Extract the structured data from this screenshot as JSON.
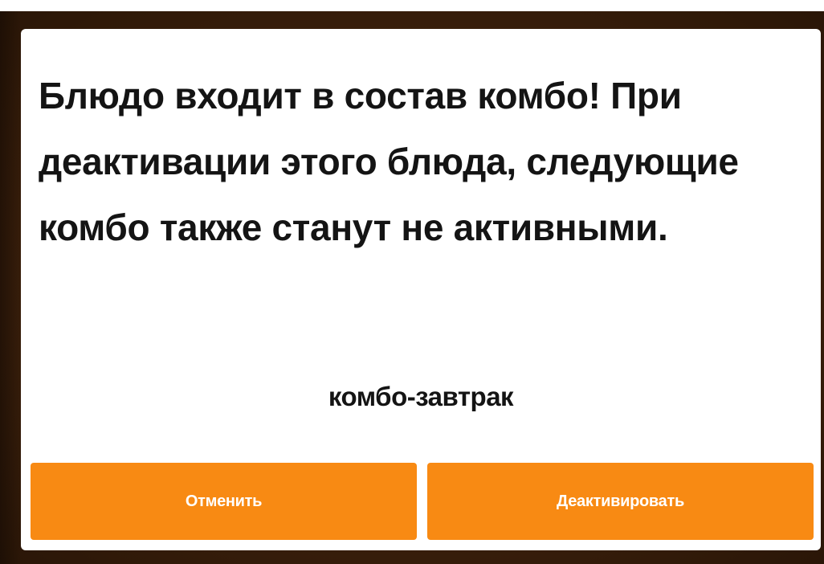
{
  "dialog": {
    "message": "Блюдо входит в состав комбо! При деактивации этого блюда, следующие комбо также станут не активными.",
    "combo_name": "комбо-завтрак",
    "cancel_label": "Отменить",
    "deactivate_label": "Деактивировать"
  },
  "colors": {
    "button": "#f88a13",
    "button_text": "#ffffff",
    "text": "#141414",
    "backdrop": "#3a1f0b"
  }
}
